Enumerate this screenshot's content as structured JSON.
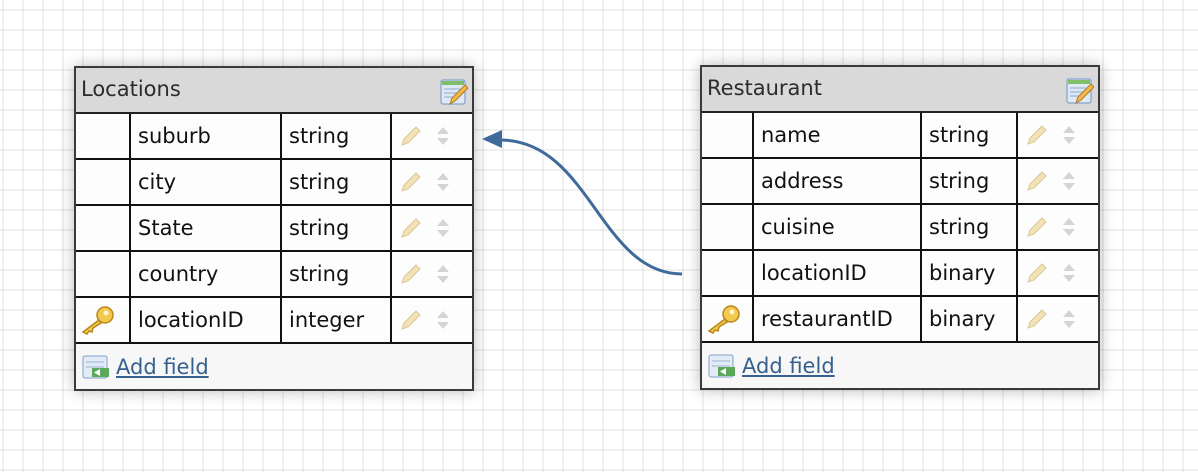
{
  "colors": {
    "connector": "#3f6a9a",
    "link": "#36618e",
    "header_bg": "#d9d9d9"
  },
  "tables": [
    {
      "title": "Locations",
      "add_field_label": "Add field",
      "fields": [
        {
          "name": "suburb",
          "type": "string",
          "key": false
        },
        {
          "name": "city",
          "type": "string",
          "key": false
        },
        {
          "name": "State",
          "type": "string",
          "key": false
        },
        {
          "name": "country",
          "type": "string",
          "key": false
        },
        {
          "name": "locationID",
          "type": "integer",
          "key": true
        }
      ]
    },
    {
      "title": "Restaurant",
      "add_field_label": "Add field",
      "fields": [
        {
          "name": "name",
          "type": "string",
          "key": false
        },
        {
          "name": "address",
          "type": "string",
          "key": false
        },
        {
          "name": "cuisine",
          "type": "string",
          "key": false
        },
        {
          "name": "locationID",
          "type": "binary",
          "key": false
        },
        {
          "name": "restaurantID",
          "type": "binary",
          "key": true
        }
      ]
    }
  ],
  "icons": {
    "edit_table": "table-edit-icon",
    "key": "key-icon",
    "edit_field": "pencil-icon",
    "reorder": "up-down-arrows-icon",
    "add_field": "add-field-icon"
  }
}
